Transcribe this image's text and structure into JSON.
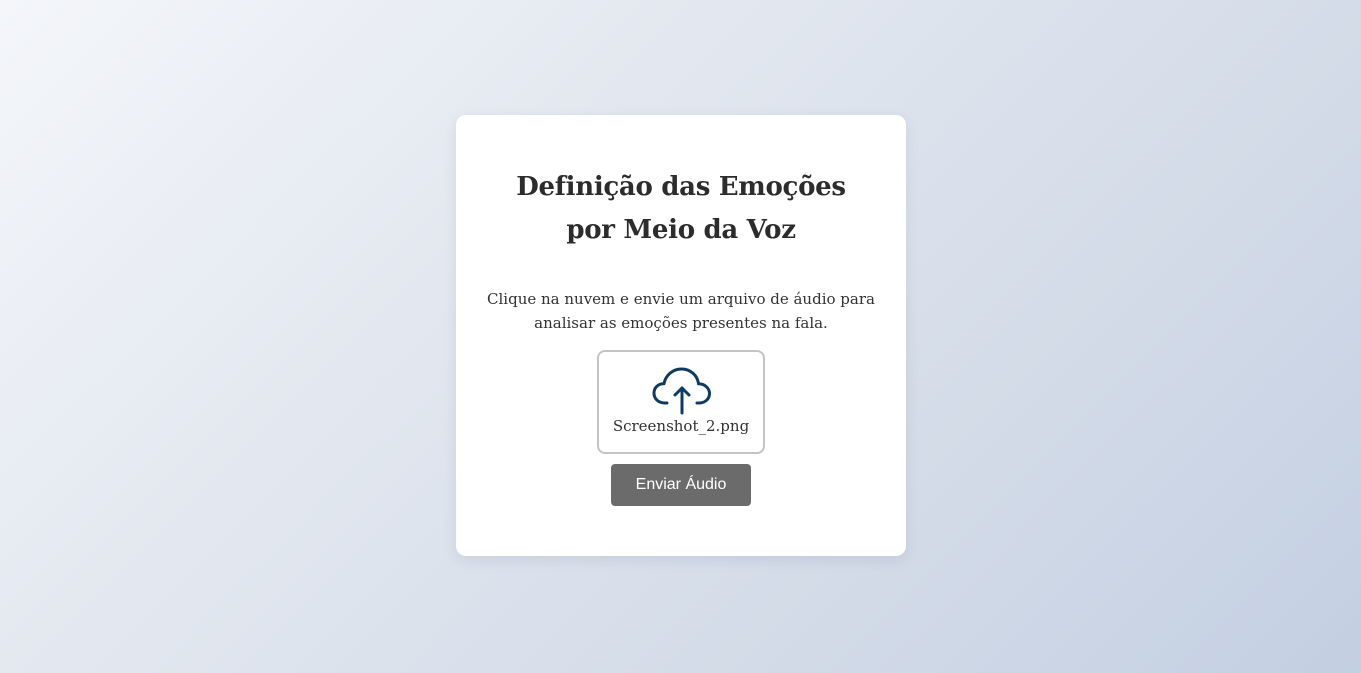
{
  "card": {
    "title": "Definição das Emoções por Meio da Voz",
    "description": "Clique na nuvem e envie um arquivo de áudio para analisar as emoções presentes na fala."
  },
  "upload": {
    "icon": "cloud-upload-icon",
    "file_name": "Screenshot_2.png"
  },
  "submit": {
    "label": "Enviar Áudio"
  },
  "colors": {
    "icon": "#0d3b66",
    "button": "#6b6b6b",
    "title": "#2c2c2c"
  }
}
